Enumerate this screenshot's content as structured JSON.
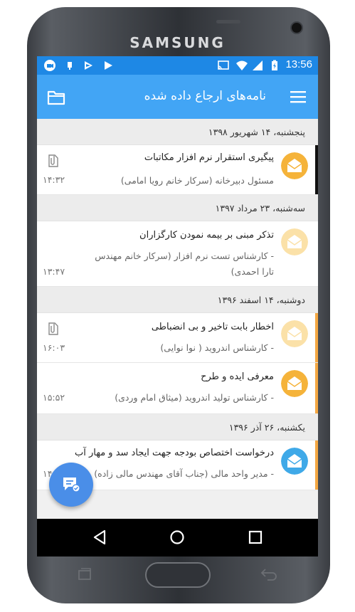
{
  "device": {
    "brand": "SAMSUNG"
  },
  "status_bar": {
    "time": "13:56"
  },
  "app_bar": {
    "title": "نامه‌های ارجاع داده شده"
  },
  "groups": [
    {
      "date": "پنجشنبه، ۱۴ شهریور ۱۳۹۸",
      "items": [
        {
          "subject": "پیگیری استقرار نرم افزار مکاتبات",
          "sender": "مسئول دبیرخانه (سرکار خانم رویا امامی)",
          "time": "۱۴:۳۲",
          "attachment": true,
          "read": false,
          "accent_color": "#111111"
        }
      ]
    },
    {
      "date": "سه‌شنبه، ۲۳ مرداد ۱۳۹۷",
      "items": [
        {
          "subject": "تذکر مبنی بر بیمه نمودن کارگزاران",
          "sender": "- کارشناس تست نرم افزار (سرکار خانم مهندس تارا احمدی)",
          "time": "۱۳:۴۷",
          "attachment": false,
          "read": true,
          "accent_color": ""
        }
      ]
    },
    {
      "date": "دوشنبه، ۱۴ اسفند ۱۳۹۶",
      "items": [
        {
          "subject": "اخطار بابت تاخیر و بی انضباطی",
          "sender": "- کارشناس اندروید ( نوا نوایی)",
          "time": "۱۶:۰۳",
          "attachment": true,
          "read": true,
          "accent_color": "#f4a742"
        },
        {
          "subject": "معرفی ایده و طرح",
          "sender": "- کارشناس تولید اندروید (میثاق امام وردی)",
          "time": "۱۵:۵۲",
          "attachment": false,
          "read": false,
          "accent_color": ""
        }
      ]
    },
    {
      "date": "یکشنبه، ۲۶ آذر ۱۳۹۶",
      "items": [
        {
          "subject": "درخواست اختصاص بودجه جهت ایجاد سد و مهار آب",
          "sender": "- مدیر واحد مالی (جناب آقای مهندس مالی زاده)",
          "time": "۱۴",
          "attachment": false,
          "read": false,
          "accent_color": "#f4a742"
        }
      ]
    }
  ],
  "colors": {
    "status_bar": "#1e88e5",
    "app_bar": "#42a5f5",
    "avatar_unread": "#f5b33a",
    "avatar_read": "#fbe1a8",
    "avatar_blue": "#3fa9e8",
    "fab": "#4a8ee8"
  },
  "icons": {
    "app_bar_left": "folder-icon",
    "app_bar_right": "menu-icon",
    "fab": "compose-chat-icon",
    "nav": [
      "back-icon",
      "home-icon",
      "recents-icon"
    ]
  }
}
